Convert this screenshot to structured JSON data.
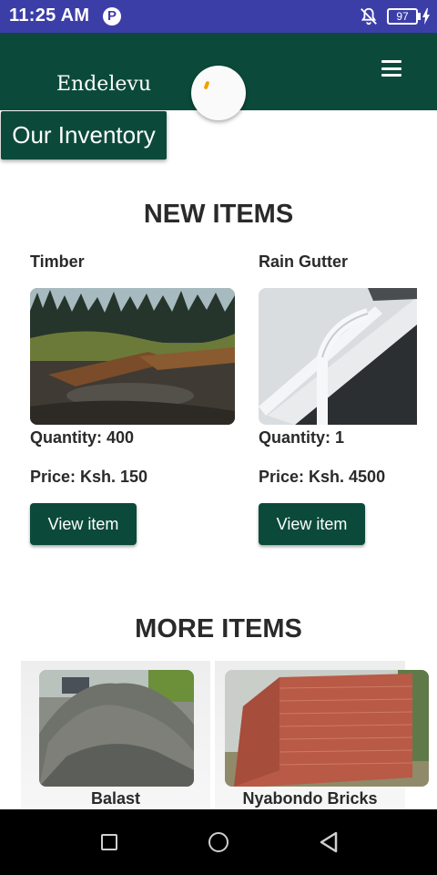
{
  "status_bar": {
    "time": "11:25 AM",
    "notification_letter": "P",
    "battery_level": "97"
  },
  "header": {
    "brand": "Endelevu"
  },
  "page": {
    "badge": "Our Inventory"
  },
  "new_items": {
    "title": "NEW ITEMS",
    "items": [
      {
        "name": "Timber",
        "quantity": "Quantity: 400",
        "price": "Price: Ksh. 150",
        "button": "View item"
      },
      {
        "name": "Rain Gutter",
        "quantity": "Quantity: 1",
        "price": "Price: Ksh. 4500",
        "button": "View item"
      }
    ]
  },
  "more_items": {
    "title": "MORE ITEMS",
    "items": [
      {
        "name": "Balast"
      },
      {
        "name": "Nyabondo Bricks"
      }
    ]
  },
  "colors": {
    "status_bar": "#3c3ea8",
    "primary": "#0b4a3a",
    "spinner_accent": "#f0a000"
  },
  "icons": [
    "p-notification-icon",
    "bell-off-icon",
    "battery-icon",
    "charging-bolt-icon",
    "menu-icon",
    "loading-spinner-icon",
    "recent-apps-icon",
    "home-icon",
    "back-icon"
  ]
}
